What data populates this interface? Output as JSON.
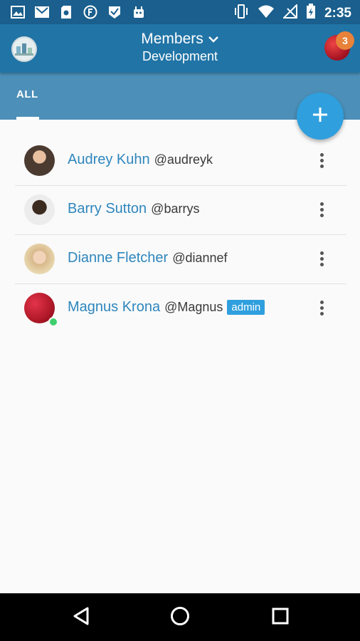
{
  "status_bar": {
    "time": "2:35",
    "left_icons": [
      "image-icon",
      "gmail-icon",
      "sd-card-icon",
      "f-circle-icon",
      "check-flag-icon",
      "android-icon"
    ],
    "right_icons": [
      "vibrate-icon",
      "wifi-icon",
      "no-signal-icon",
      "battery-charging-icon"
    ]
  },
  "app_bar": {
    "title": "Members",
    "subtitle": "Development",
    "notification_count": "3",
    "colors": {
      "app_bar": "#2174a6",
      "status_bar": "#1a5f8d",
      "tab_bar": "#4c8fb8",
      "accent": "#2f9fde"
    }
  },
  "tabs": [
    {
      "label": "ALL",
      "active": true
    }
  ],
  "fab": {
    "icon": "plus-icon"
  },
  "members": [
    {
      "name": "Audrey Kuhn",
      "handle": "@audreyk",
      "admin": false,
      "online": false,
      "avatar_color": "#4a3a30"
    },
    {
      "name": "Barry Sutton",
      "handle": "@barrys",
      "admin": false,
      "online": false,
      "avatar_color": "#2b2018"
    },
    {
      "name": "Dianne Fletcher",
      "handle": "@diannef",
      "admin": false,
      "online": false,
      "avatar_color": "#d8b88a"
    },
    {
      "name": "Magnus Krona",
      "handle": "@Magnus",
      "admin": true,
      "admin_label": "admin",
      "online": true,
      "avatar_color": "#b01828"
    }
  ],
  "nav_bar": {
    "buttons": [
      "back-icon",
      "home-icon",
      "recents-icon"
    ]
  }
}
